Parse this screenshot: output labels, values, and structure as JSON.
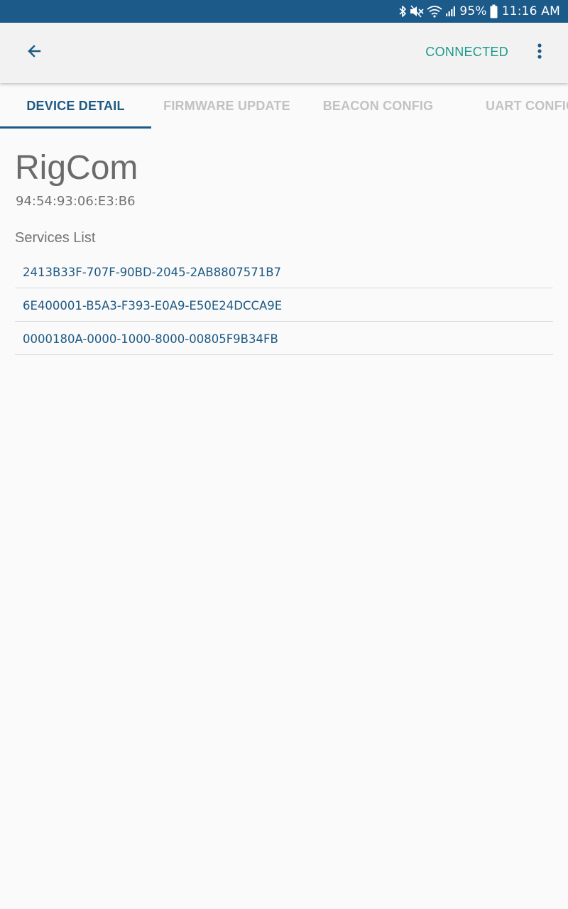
{
  "status_bar": {
    "battery_text": "95%",
    "time": "11:16 AM",
    "icons": [
      "bluetooth-icon",
      "mute-icon",
      "wifi-icon",
      "signal-icon",
      "battery-icon"
    ],
    "background_color": "#1c5a8a"
  },
  "app_bar": {
    "back_icon": "arrow-back-icon",
    "connection_status": "CONNECTED",
    "connection_status_color": "#1a9a8b",
    "overflow_icon": "more-vert-icon"
  },
  "tabs": [
    {
      "label": "DEVICE DETAIL",
      "active": true
    },
    {
      "label": "FIRMWARE UPDATE",
      "active": false
    },
    {
      "label": "BEACON CONFIG",
      "active": false
    },
    {
      "label": "UART CONFIG",
      "active": false
    }
  ],
  "accent_color": "#1e5a84",
  "device": {
    "name": "RigCom",
    "mac": "94:54:93:06:E3:B6"
  },
  "services": {
    "label": "Services List",
    "items": [
      "2413B33F-707F-90BD-2045-2AB8807571B7",
      "6E400001-B5A3-F393-E0A9-E50E24DCCA9E",
      "0000180A-0000-1000-8000-00805F9B34FB"
    ]
  }
}
